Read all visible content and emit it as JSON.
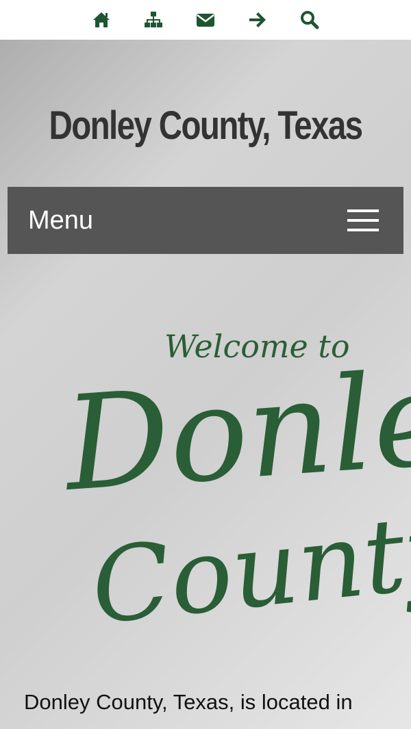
{
  "topbar": {
    "icons": [
      "home-icon",
      "sitemap-icon",
      "envelope-icon",
      "arrow-right-icon",
      "search-icon"
    ],
    "color": "#1e5631"
  },
  "header": {
    "site_title": "Donley County, Texas"
  },
  "nav": {
    "menu_label": "Menu"
  },
  "hero": {
    "logo_line1": "Welcome to",
    "logo_line2": "Donley",
    "logo_line3": "County",
    "logo_color": "#2a5e36"
  },
  "content": {
    "intro_text": "Donley County, Texas, is located in"
  }
}
